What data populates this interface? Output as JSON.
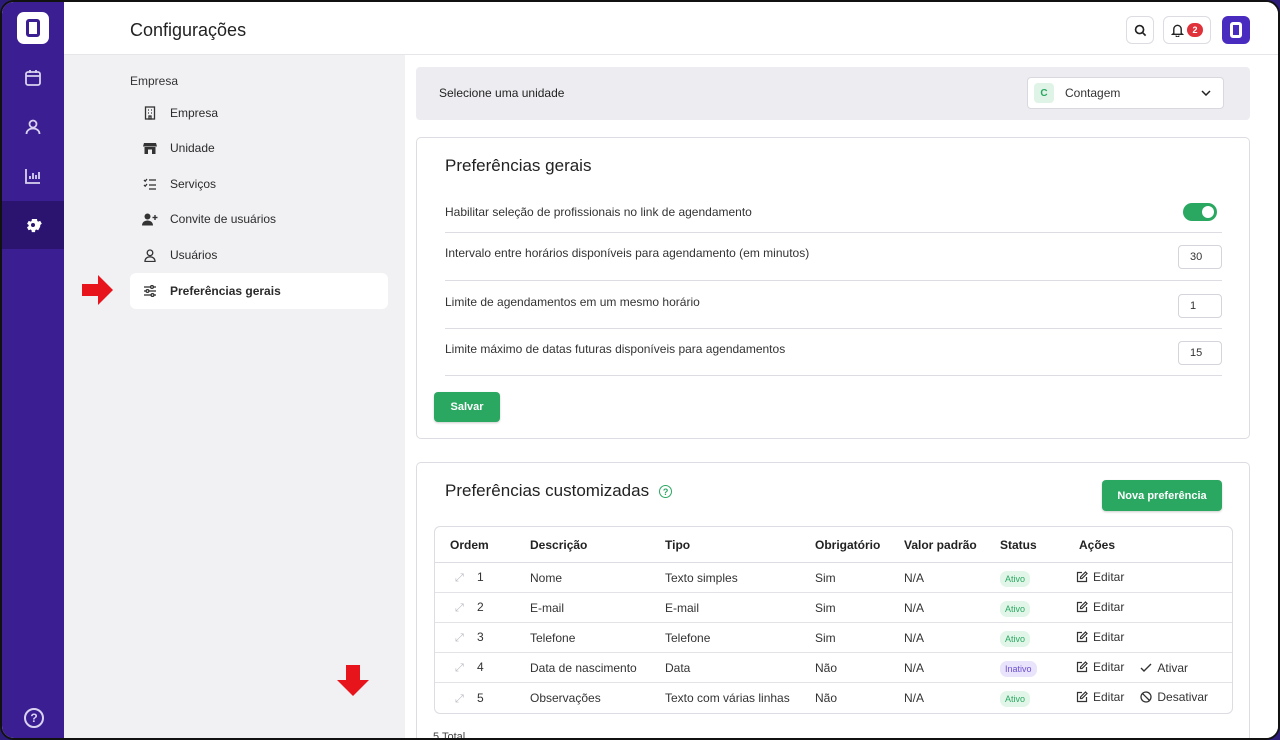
{
  "app": {
    "page_title": "Configurações",
    "notification_count": "2"
  },
  "rail": {
    "items": [
      {
        "icon": "calendar-icon"
      },
      {
        "icon": "user-icon"
      },
      {
        "icon": "chart-icon"
      },
      {
        "icon": "gear-icon",
        "active": true
      }
    ]
  },
  "subnav": {
    "section_title": "Empresa",
    "items": [
      {
        "label": "Empresa",
        "icon": "building-icon"
      },
      {
        "label": "Unidade",
        "icon": "store-icon"
      },
      {
        "label": "Serviços",
        "icon": "list-check-icon"
      },
      {
        "label": "Convite de usuários",
        "icon": "user-plus-icon"
      },
      {
        "label": "Usuários",
        "icon": "user-icon"
      },
      {
        "label": "Preferências gerais",
        "icon": "sliders-icon",
        "active": true
      }
    ]
  },
  "unit": {
    "label": "Selecione uma unidade",
    "initial": "C",
    "selected": "Contagem"
  },
  "general": {
    "title": "Preferências gerais",
    "toggle_label": "Habilitar seleção de profissionais no link de agendamento",
    "toggle_on": true,
    "fields": [
      {
        "label": "Intervalo entre horários disponíveis para agendamento (em minutos)",
        "value": "30"
      },
      {
        "label": "Limite de agendamentos em um mesmo horário",
        "value": "1"
      },
      {
        "label": "Limite máximo de datas futuras disponíveis para agendamentos",
        "value": "15"
      }
    ],
    "save_label": "Salvar"
  },
  "custom": {
    "title": "Preferências customizadas",
    "new_label": "Nova preferência",
    "columns": [
      "Ordem",
      "Descrição",
      "Tipo",
      "Obrigatório",
      "Valor padrão",
      "Status",
      "Ações"
    ],
    "rows": [
      {
        "order": "1",
        "desc": "Nome",
        "type": "Texto simples",
        "required": "Sim",
        "default": "N/A",
        "status": "Ativo",
        "edit": "Editar",
        "extra": ""
      },
      {
        "order": "2",
        "desc": "E-mail",
        "type": "E-mail",
        "required": "Sim",
        "default": "N/A",
        "status": "Ativo",
        "edit": "Editar",
        "extra": ""
      },
      {
        "order": "3",
        "desc": "Telefone",
        "type": "Telefone",
        "required": "Sim",
        "default": "N/A",
        "status": "Ativo",
        "edit": "Editar",
        "extra": ""
      },
      {
        "order": "4",
        "desc": "Data de nascimento",
        "type": "Data",
        "required": "Não",
        "default": "N/A",
        "status": "Inativo",
        "edit": "Editar",
        "extra": "Ativar"
      },
      {
        "order": "5",
        "desc": "Observações",
        "type": "Texto com várias linhas",
        "required": "Não",
        "default": "N/A",
        "status": "Ativo",
        "edit": "Editar",
        "extra": "Desativar"
      }
    ],
    "total": "5 Total"
  },
  "colors": {
    "brand": "#3b1f92",
    "accent_green": "#2aa862",
    "annotation_red": "#e8141c"
  }
}
